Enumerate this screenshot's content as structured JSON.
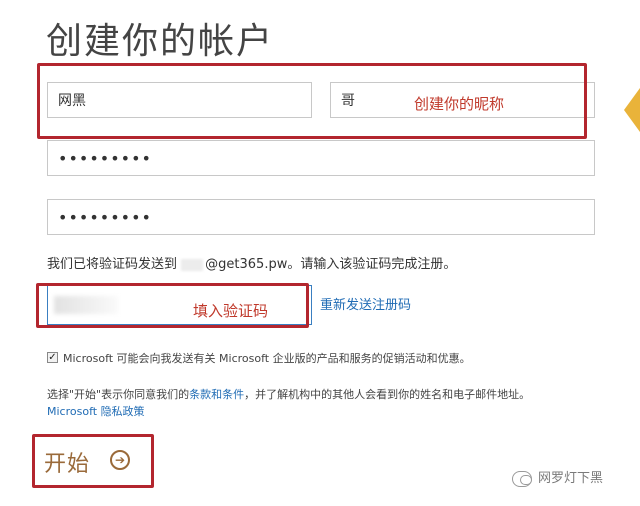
{
  "page": {
    "title": "创建你的帐户"
  },
  "form": {
    "first_name": "网黑",
    "last_name": "哥",
    "password_mask": "•••••••••",
    "confirm_password_mask": "•••••••••",
    "sent_prefix": "我们已将验证码发送到",
    "sent_email_suffix": "@get365.pw",
    "sent_suffix": "。请输入该验证码完成注册。",
    "resend_label": "重新发送注册码",
    "marketing_checkbox_label": "Microsoft 可能会向我发送有关 Microsoft 企业版的产品和服务的促销活动和优惠。",
    "terms_prefix": "选择\"开始\"表示你同意我们的",
    "terms_link": "条款和条件",
    "terms_suffix": "，并了解机构中的其他人会看到你的姓名和电子邮件地址。",
    "privacy_prefix": "Microsoft",
    "privacy_link": "隐私政策",
    "start_label": "开始"
  },
  "annotations": {
    "name_hint": "创建你的昵称",
    "code_hint": "填入验证码"
  },
  "watermark": {
    "text": "网罗灯下黑"
  },
  "icons": {
    "start_arrow": "arrow-right-circle-icon",
    "checkbox": "checkbox-checked-icon",
    "watermark": "wechat-icon"
  },
  "colors": {
    "annotation_red": "#b3262e",
    "link_blue": "#1f6bb4",
    "start_brown": "#9a6a3a"
  }
}
